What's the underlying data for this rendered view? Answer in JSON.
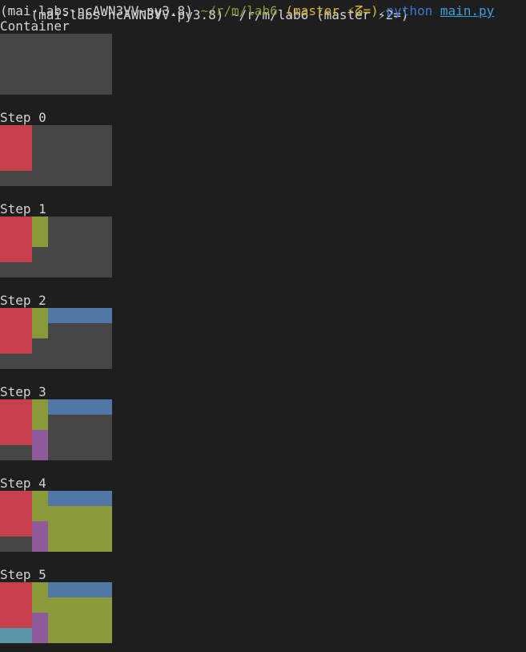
{
  "terminal": {
    "top_partial_text": "(mai-labs-ncAWN3VV-py3.8) ~/r/m/lab6 (master ⚡2=)",
    "prompt": {
      "env": "(mai-labs-ncAWN3VV-py3.8)",
      "path": "~/r/m/lab6",
      "branch_open": "(master",
      "branch_status": "⚡ᘔ=)",
      "command": "python",
      "file": "main.py"
    }
  },
  "colors": {
    "background": "#1e1e1e",
    "empty": "#464646",
    "red": "#c5404a",
    "olive": "#8a9a3a",
    "blue": "#5077a5",
    "purple": "#8e5a98",
    "teal": "#5b95a8"
  },
  "sections": [
    {
      "label": "Container"
    },
    {
      "label": "Step 0"
    },
    {
      "label": "Step 1"
    },
    {
      "label": "Step 2"
    },
    {
      "label": "Step 3"
    },
    {
      "label": "Step 4"
    },
    {
      "label": "Step 5"
    }
  ]
}
